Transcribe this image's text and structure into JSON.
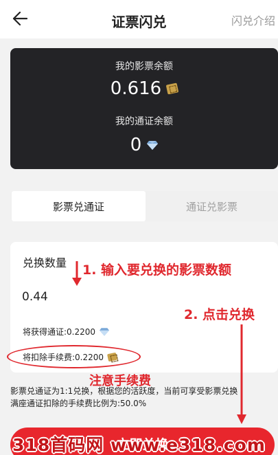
{
  "header": {
    "title": "证票闪兑",
    "intro_link": "闪兑介绍"
  },
  "balance": {
    "ticket_label": "我的影票余额",
    "ticket_value": "0.616",
    "token_label": "我的通证余额",
    "token_value": "0"
  },
  "tabs": [
    {
      "label": "影票兑通证",
      "active": true
    },
    {
      "label": "通证兑影票",
      "active": false
    }
  ],
  "form": {
    "amount_label": "兑换数量",
    "amount_value": "0.44",
    "receive_text": "将获得通证:0.2200",
    "fee_text": "将扣除手续费:0.2200"
  },
  "annotations": {
    "step1": "1. 输入要兑换的影票数额",
    "step2": "2. 点击兑换",
    "fee_note": "注意手续费"
  },
  "notice": {
    "line1": "影票兑通证为1:1兑换，根据您的活跃度，当前可享受影票兑换",
    "line2": "满座通证扣除的手续费比例为:50.0%"
  },
  "submit_label": "立即兑换",
  "watermark": "318首码网 www.e318.com",
  "colors": {
    "accent": "#e8262d",
    "annotation": "#e0282e",
    "card_dark": "#232326"
  },
  "icons": {
    "back": "arrow-left",
    "ticket": "ticket-icon",
    "token": "gem-icon"
  }
}
